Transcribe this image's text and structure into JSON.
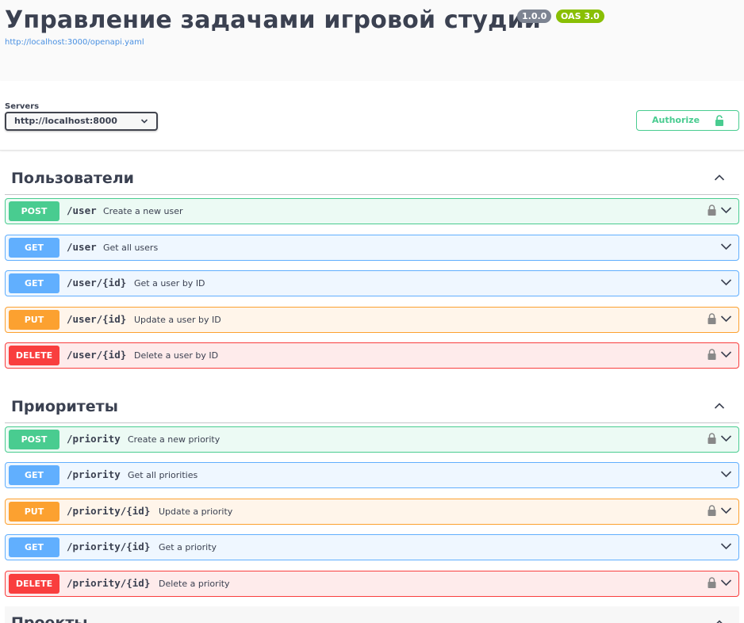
{
  "info": {
    "title": "Управление задачами игровой студии",
    "version": "1.0.0",
    "oas": "OAS 3.0",
    "spec_url": "http://localhost:3000/openapi.yaml"
  },
  "servers": {
    "label": "Servers",
    "selected": "http://localhost:8000"
  },
  "authorize": {
    "label": "Authorize"
  },
  "icons": {
    "lock": "lock-icon",
    "chevron": "chevron-down-icon",
    "collapse": "chevron-up-icon"
  },
  "colors": {
    "post": "#49cc90",
    "get": "#61affe",
    "put": "#fca130",
    "delete": "#f93e3e"
  },
  "tags": [
    {
      "name": "Пользователи",
      "operations": [
        {
          "method": "POST",
          "path": "/user",
          "summary": "Create a new user",
          "locked": true
        },
        {
          "method": "GET",
          "path": "/user",
          "summary": "Get all users",
          "locked": false
        },
        {
          "method": "GET",
          "path": "/user/{id}",
          "summary": "Get a user by ID",
          "locked": false
        },
        {
          "method": "PUT",
          "path": "/user/{id}",
          "summary": "Update a user by ID",
          "locked": true
        },
        {
          "method": "DELETE",
          "path": "/user/{id}",
          "summary": "Delete a user by ID",
          "locked": true
        }
      ]
    },
    {
      "name": "Приоритеты",
      "operations": [
        {
          "method": "POST",
          "path": "/priority",
          "summary": "Create a new priority",
          "locked": true
        },
        {
          "method": "GET",
          "path": "/priority",
          "summary": "Get all priorities",
          "locked": false
        },
        {
          "method": "PUT",
          "path": "/priority/{id}",
          "summary": "Update a priority",
          "locked": true
        },
        {
          "method": "GET",
          "path": "/priority/{id}",
          "summary": "Get a priority",
          "locked": false
        },
        {
          "method": "DELETE",
          "path": "/priority/{id}",
          "summary": "Delete a priority",
          "locked": true
        }
      ]
    },
    {
      "name": "Проекты",
      "operations": []
    }
  ]
}
